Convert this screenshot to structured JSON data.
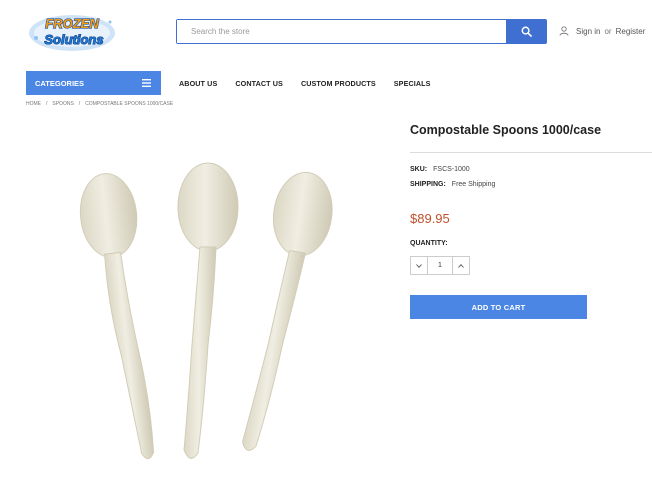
{
  "header": {
    "logo_text": "Frozen Solutions",
    "search": {
      "placeholder": "Search the store"
    },
    "account": {
      "sign_in": "Sign in",
      "or": "or",
      "register": "Register"
    }
  },
  "nav": {
    "categories_label": "CATEGORIES",
    "items": [
      "ABOUT US",
      "CONTACT US",
      "CUSTOM PRODUCTS",
      "SPECIALS"
    ]
  },
  "breadcrumb": [
    "HOME",
    "SPOONS",
    "COMPOSTABLE SPOONS 1000/CASE"
  ],
  "product": {
    "title": "Compostable Spoons 1000/case",
    "sku_label": "SKU:",
    "sku": "FSCS-1000",
    "shipping_label": "SHIPPING:",
    "shipping": "Free Shipping",
    "price": "$89.95",
    "quantity_label": "QUANTITY:",
    "quantity": "1",
    "add_to_cart": "ADD TO CART"
  },
  "colors": {
    "accent_blue": "#4b86e4",
    "search_blue": "#3f6fd1",
    "price": "#c2502d"
  },
  "icons": [
    "logo",
    "search-icon",
    "user-icon",
    "menu-icon",
    "chevron-down-icon",
    "chevron-up-icon"
  ]
}
